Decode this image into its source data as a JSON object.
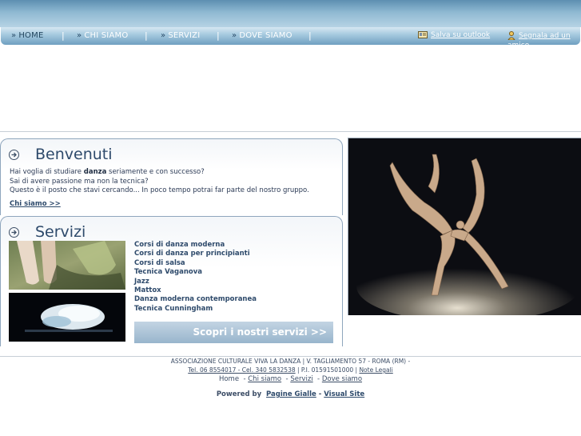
{
  "nav": {
    "items": [
      {
        "label": "HOME"
      },
      {
        "label": "CHI SIAMO"
      },
      {
        "label": "SERVIZI"
      },
      {
        "label": "DOVE SIAMO"
      }
    ],
    "separator": "|",
    "save_outlook": "Salva su outlook",
    "recommend": "Segnala ad un amico"
  },
  "welcome": {
    "title": "Benvenuti",
    "line1_pre": "Hai voglia di studiare ",
    "line1_bold": "danza",
    "line1_post": " seriamente e con successo?",
    "line2": "Sai di avere passione ma non la tecnica?",
    "line3": "Questo è il posto che stavi cercando... In poco tempo potrai far parte del nostro gruppo.",
    "link": "Chi siamo >>"
  },
  "services": {
    "title": "Servizi",
    "items": [
      "Corsi di danza moderna",
      "Corsi di danza per principianti",
      "Corsi di salsa",
      "Tecnica Vaganova",
      "Jazz",
      "Mattox",
      "Danza moderna contemporanea",
      "Tecnica Cunningham"
    ],
    "cta": "Scopri i nostri servizi >>"
  },
  "footer": {
    "line1": "ASSOCIAZIONE CULTURALE VIVA LA DANZA | V. TAGLIAMENTO 57 - ROMA (RM) -",
    "phones": "Tel. 06 8554017 - Cel. 340 5832538",
    "vat": " | P.I. 01591501000 | ",
    "legal": "Note Legali",
    "links": [
      "Home",
      "Chi siamo",
      "Servizi",
      "Dove siamo"
    ],
    "powered_label": "Powered by",
    "powered_links": [
      "Pagine Gialle",
      "Visual Site"
    ]
  },
  "colors": {
    "accent": "#2e4a6b",
    "nav_top": "#5d8fb1",
    "cta": "#98b5cc"
  }
}
